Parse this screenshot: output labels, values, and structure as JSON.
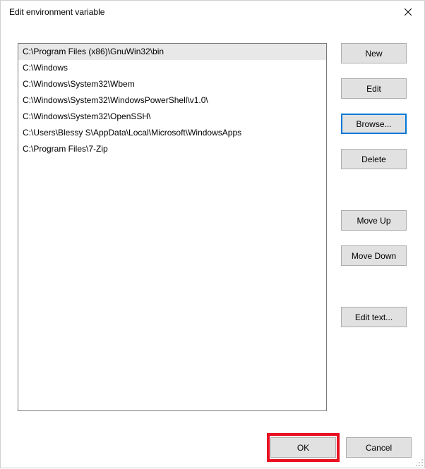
{
  "dialog": {
    "title": "Edit environment variable"
  },
  "entries": [
    "C:\\Program Files (x86)\\GnuWin32\\bin",
    "C:\\Windows",
    "C:\\Windows\\System32\\Wbem",
    "C:\\Windows\\System32\\WindowsPowerShell\\v1.0\\",
    "C:\\Windows\\System32\\OpenSSH\\",
    "C:\\Users\\Blessy S\\AppData\\Local\\Microsoft\\WindowsApps",
    "C:\\Program Files\\7-Zip"
  ],
  "selected_index": 0,
  "buttons": {
    "new": "New",
    "edit": "Edit",
    "browse": "Browse...",
    "delete": "Delete",
    "moveUp": "Move Up",
    "moveDown": "Move Down",
    "editText": "Edit text...",
    "ok": "OK",
    "cancel": "Cancel"
  }
}
